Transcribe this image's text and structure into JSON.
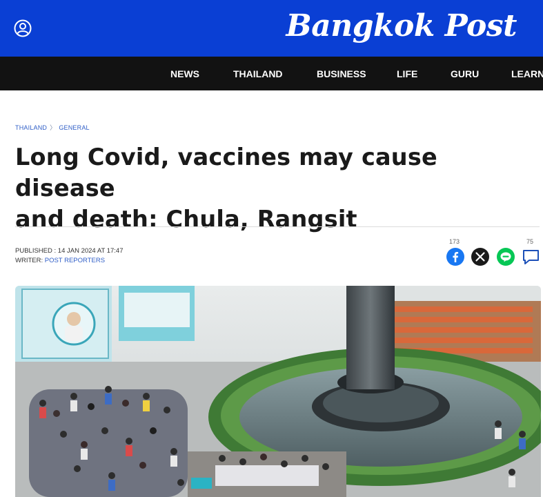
{
  "site": {
    "logo_text": "Bangkok Post",
    "brand_color": "#0a3fd4",
    "nav_bg": "#121212",
    "link_color": "#2f5ec7"
  },
  "header": {
    "user_icon": "user-account-icon"
  },
  "nav": {
    "items": [
      "NEWS",
      "THAILAND",
      "BUSINESS",
      "LIFE",
      "GURU",
      "LEARN"
    ]
  },
  "breadcrumb": {
    "items": [
      "THAILAND",
      "GENERAL"
    ],
    "separator": "〉"
  },
  "article": {
    "headline_line1": "Long Covid, vaccines may cause disease",
    "headline_line2": "and death: Chula, Rangsit",
    "published_label": "PUBLISHED : ",
    "published_value": "14 JAN 2024 AT 17:47",
    "writer_label": "WRITER: ",
    "writer_value": "POST REPORTERS"
  },
  "share": {
    "facebook_count": "173",
    "comment_count": "75",
    "icons": [
      "facebook-icon",
      "x-icon",
      "line-icon",
      "comment-icon"
    ]
  },
  "hero_image": {
    "description_icon": "photo-vaccination-centre"
  }
}
